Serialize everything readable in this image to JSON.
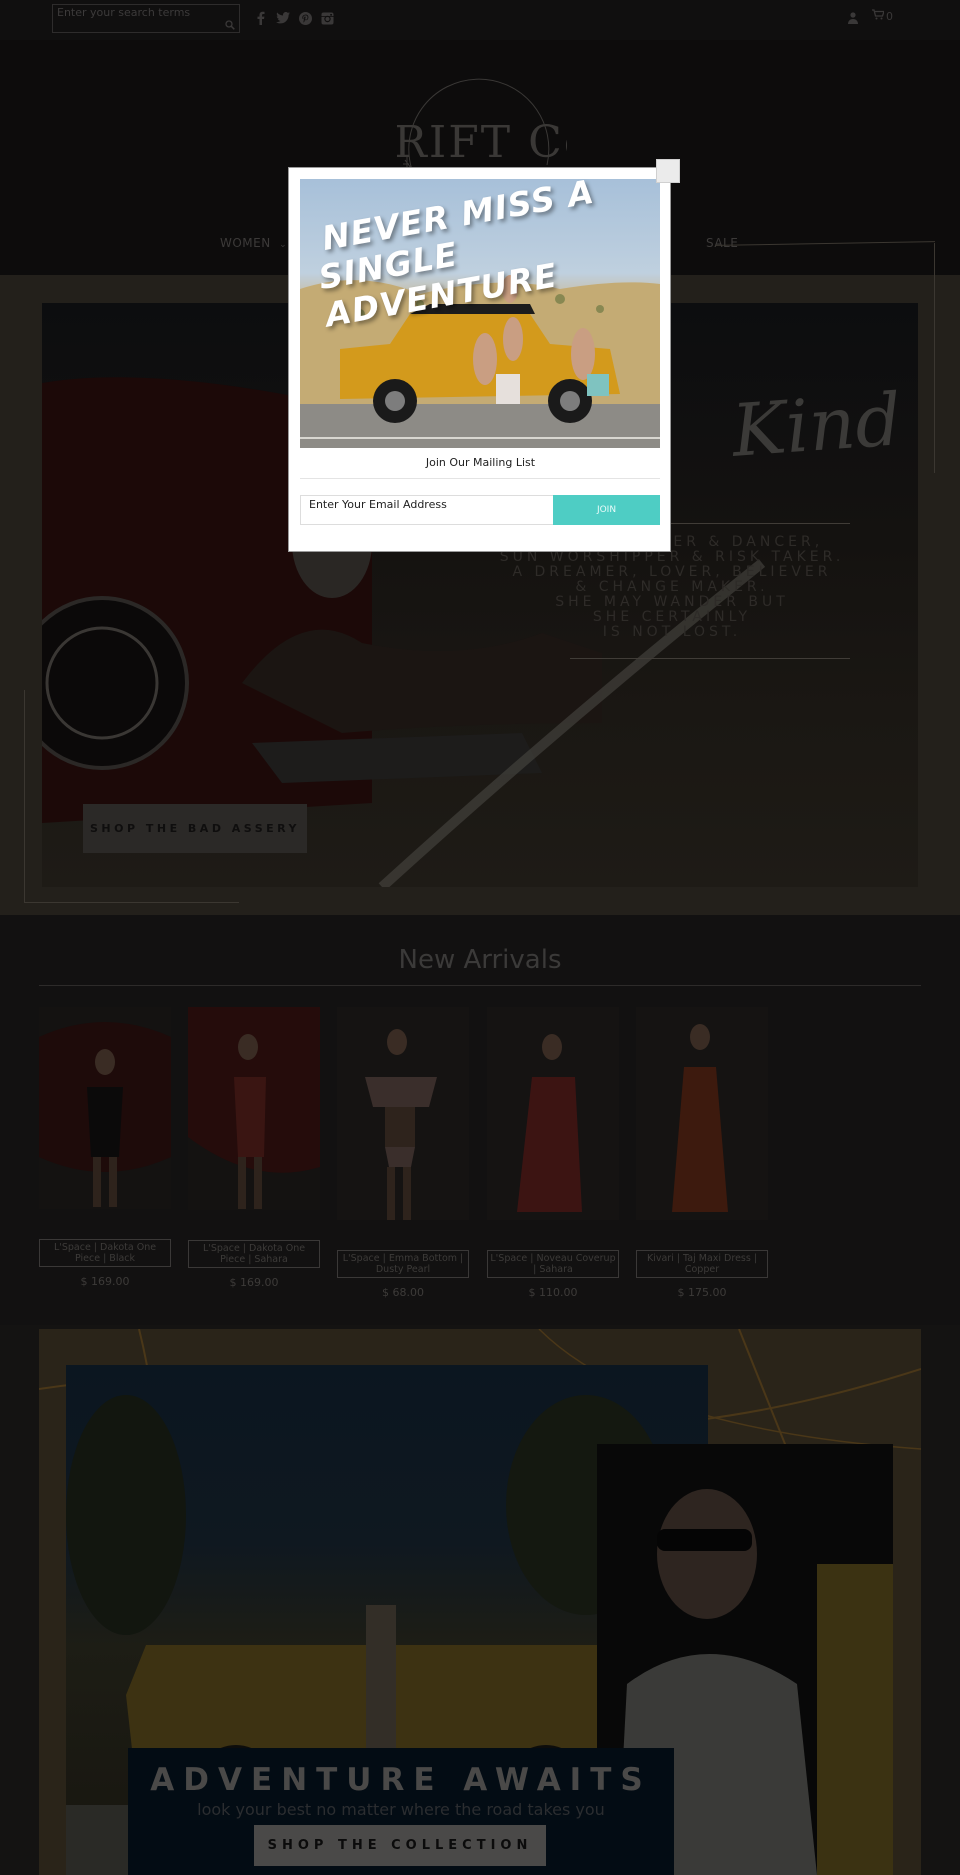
{
  "topbar": {
    "search_placeholder": "Enter your search terms",
    "social": [
      "facebook-icon",
      "twitter-icon",
      "pinterest-icon",
      "instagram-icon"
    ],
    "cart_count": "0"
  },
  "header": {
    "logo_text": "DRIFT Co.",
    "nav": [
      {
        "label": "WOMEN",
        "has_dropdown": true
      },
      {
        "label": "SALE",
        "has_dropdown": false
      }
    ]
  },
  "hero": {
    "script_title": "Kind",
    "poem_lines": [
      "TER & DANCER,",
      "SUN WORSHIPPER & RISK TAKER.",
      "A DREAMER, LOVER, BELIEVER",
      "& CHANGE MAKER.",
      "SHE MAY WANDER BUT",
      "SHE CERTAINLY",
      "IS NOT LOST."
    ],
    "button_label": "SHOP THE BAD ASSERY"
  },
  "arrivals": {
    "title": "New Arrivals",
    "products": [
      {
        "name": "L'Space | Dakota One Piece | Black",
        "price": "$ 169.00",
        "garment_color": "#0b0a0a"
      },
      {
        "name": "L'Space | Dakota One Piece | Sahara",
        "price": "$ 169.00",
        "garment_color": "#3a1512"
      },
      {
        "name": "L'Space | Emma Bottom | Dusty Pearl",
        "price": "$ 68.00",
        "garment_color": "#3a2e2b"
      },
      {
        "name": "L'Space | Noveau Coverup | Sahara",
        "price": "$ 110.00",
        "garment_color": "#3c1412"
      },
      {
        "name": "Kivari | Taj Maxi Dress | Copper",
        "price": "$ 175.00",
        "garment_color": "#3d1a0e"
      }
    ]
  },
  "adventure": {
    "title": "ADVENTURE AWAITS",
    "subtitle": "look your best no matter where the road takes you",
    "button_label": "SHOP THE COLLECTION"
  },
  "modal": {
    "headline_line1": "NEVER MISS A",
    "headline_line2": "SINGLE ADVENTURE",
    "title": "Join Our Mailing List",
    "email_placeholder": "Enter Your Email Address",
    "join_label": "JOIN",
    "accent_color": "#4ecdc4"
  }
}
